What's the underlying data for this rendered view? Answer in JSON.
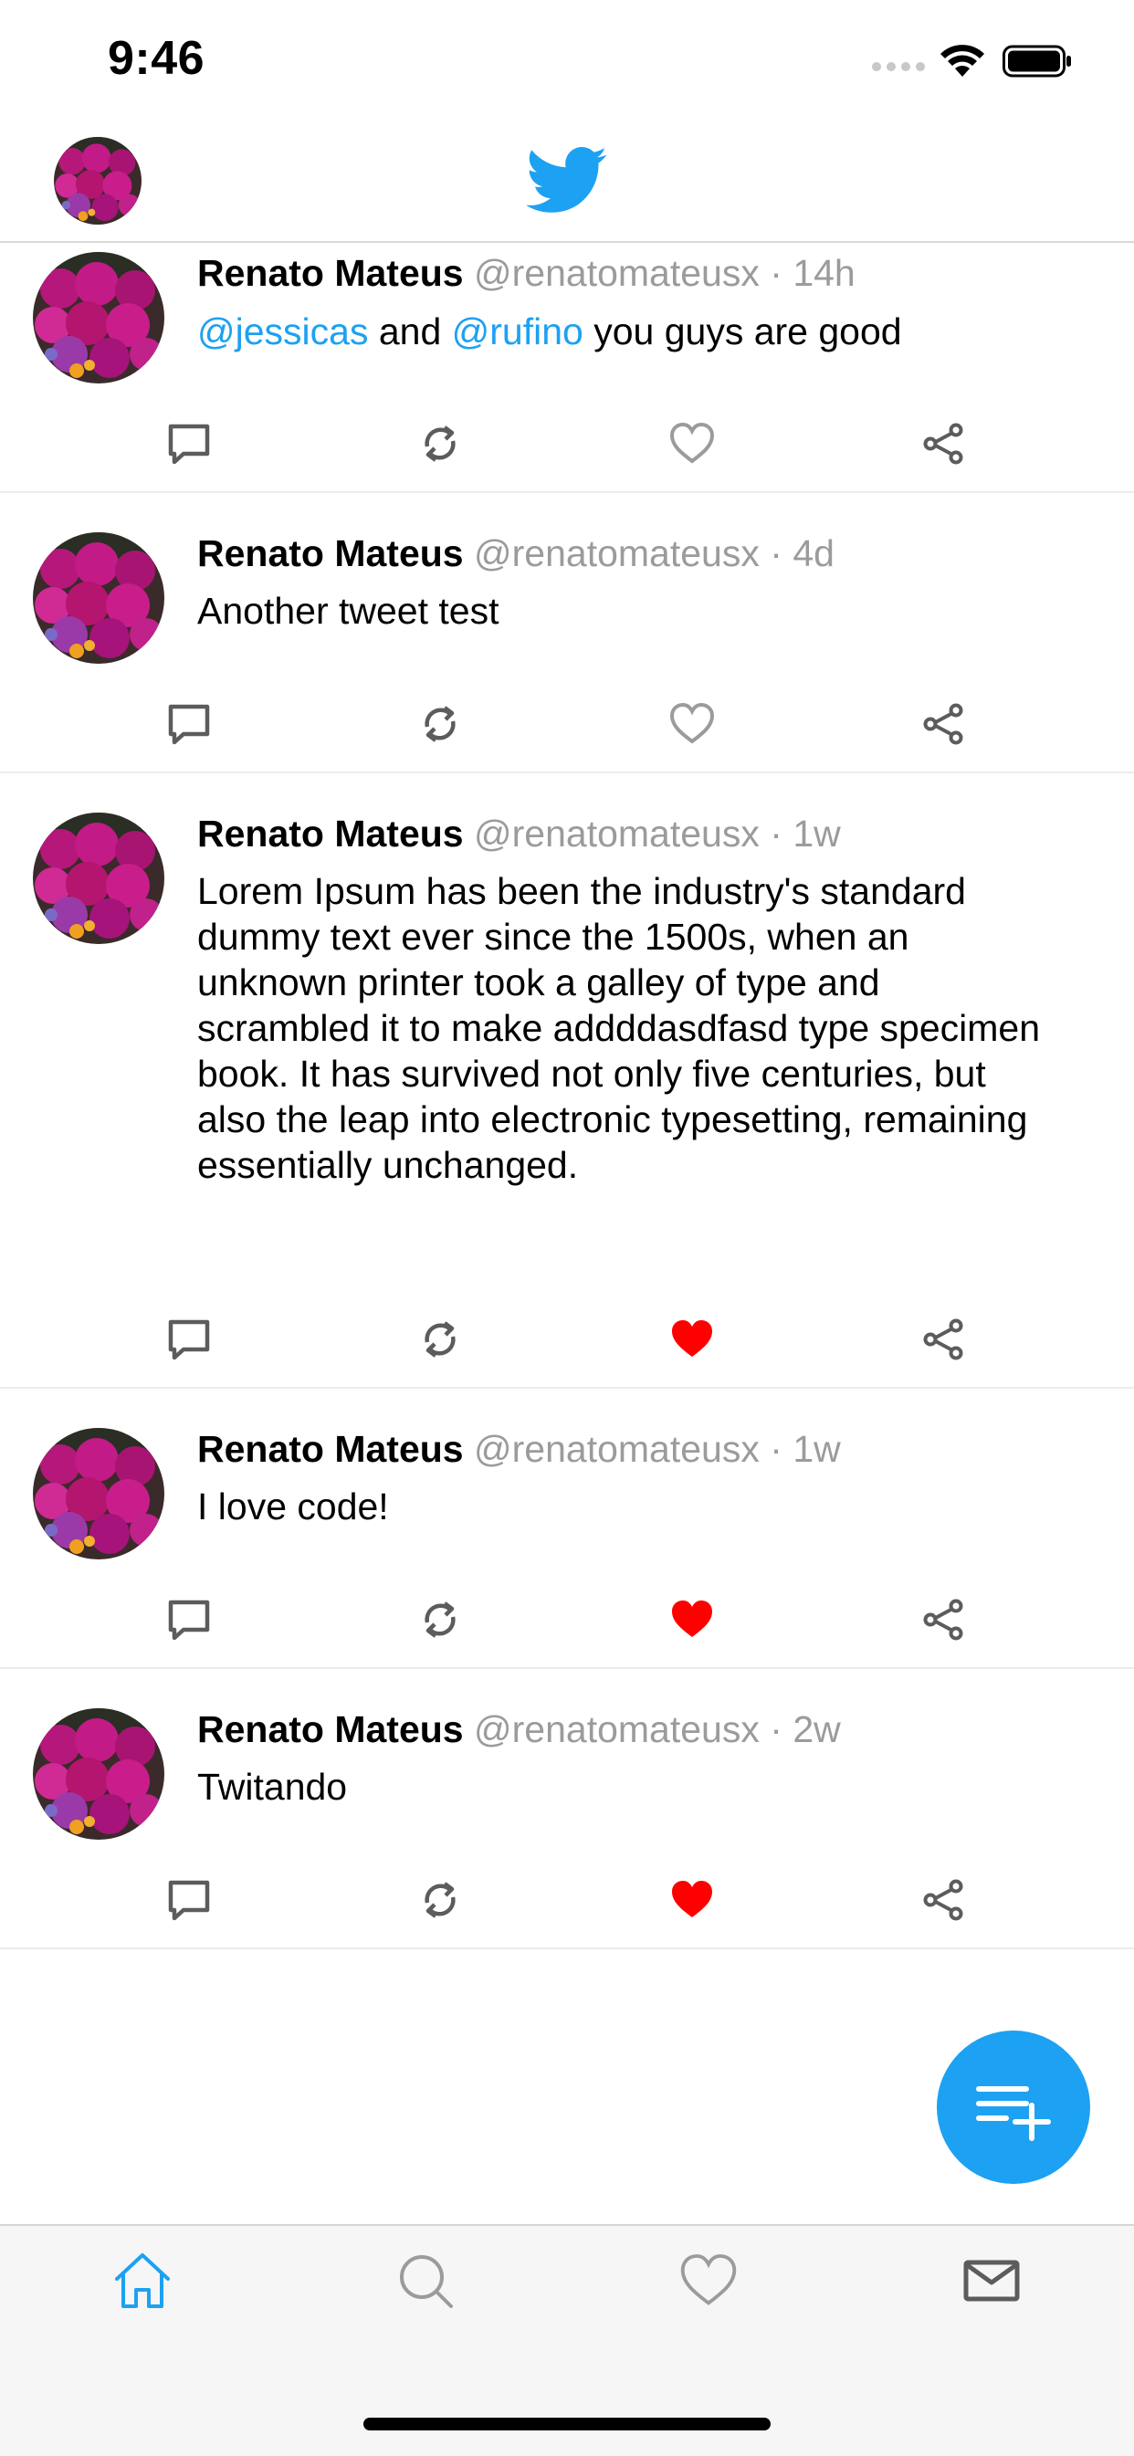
{
  "status_bar": {
    "time": "9:46"
  },
  "colors": {
    "accent": "#1da1f2",
    "like_active": "#ff0000",
    "icon_gray": "#5c5c5c",
    "meta_gray": "#9b9b9b"
  },
  "header": {
    "logo_icon": "twitter-bird-icon",
    "avatar_icon": "flower-avatar"
  },
  "tweets": [
    {
      "name": "Renato Mateus",
      "handle": "@renatomateusx",
      "dot": "·",
      "time": "14h",
      "text_parts": [
        "@jessicas",
        " and ",
        "@rufino",
        " you guys are good"
      ],
      "liked": false
    },
    {
      "name": "Renato Mateus",
      "handle": "@renatomateusx",
      "dot": "·",
      "time": "4d",
      "text": "Another tweet test",
      "liked": false
    },
    {
      "name": "Renato Mateus",
      "handle": "@renatomateusx",
      "dot": "·",
      "time": "1w",
      "text_lines": [
        "Lorem Ipsum has been the industry's standard",
        "dummy text ever since the 1500s, when an",
        "unknown printer took a galley of type and",
        "scrambled it to make addddasdfasd type specimen",
        "book. It has survived not only five centuries, but",
        "also the leap into electronic typesetting, remaining",
        "essentially unchanged."
      ],
      "liked": true
    },
    {
      "name": "Renato Mateus",
      "handle": "@renatomateusx",
      "dot": "·",
      "time": "1w",
      "text": "I love code!",
      "liked": true
    },
    {
      "name": "Renato Mateus",
      "handle": "@renatomateusx",
      "dot": "·",
      "time": "2w",
      "text": "Twitando",
      "liked": true
    }
  ],
  "tab_bar": {
    "selected": "home",
    "items": [
      "home-icon",
      "search-icon",
      "heart-icon",
      "mail-icon"
    ]
  }
}
